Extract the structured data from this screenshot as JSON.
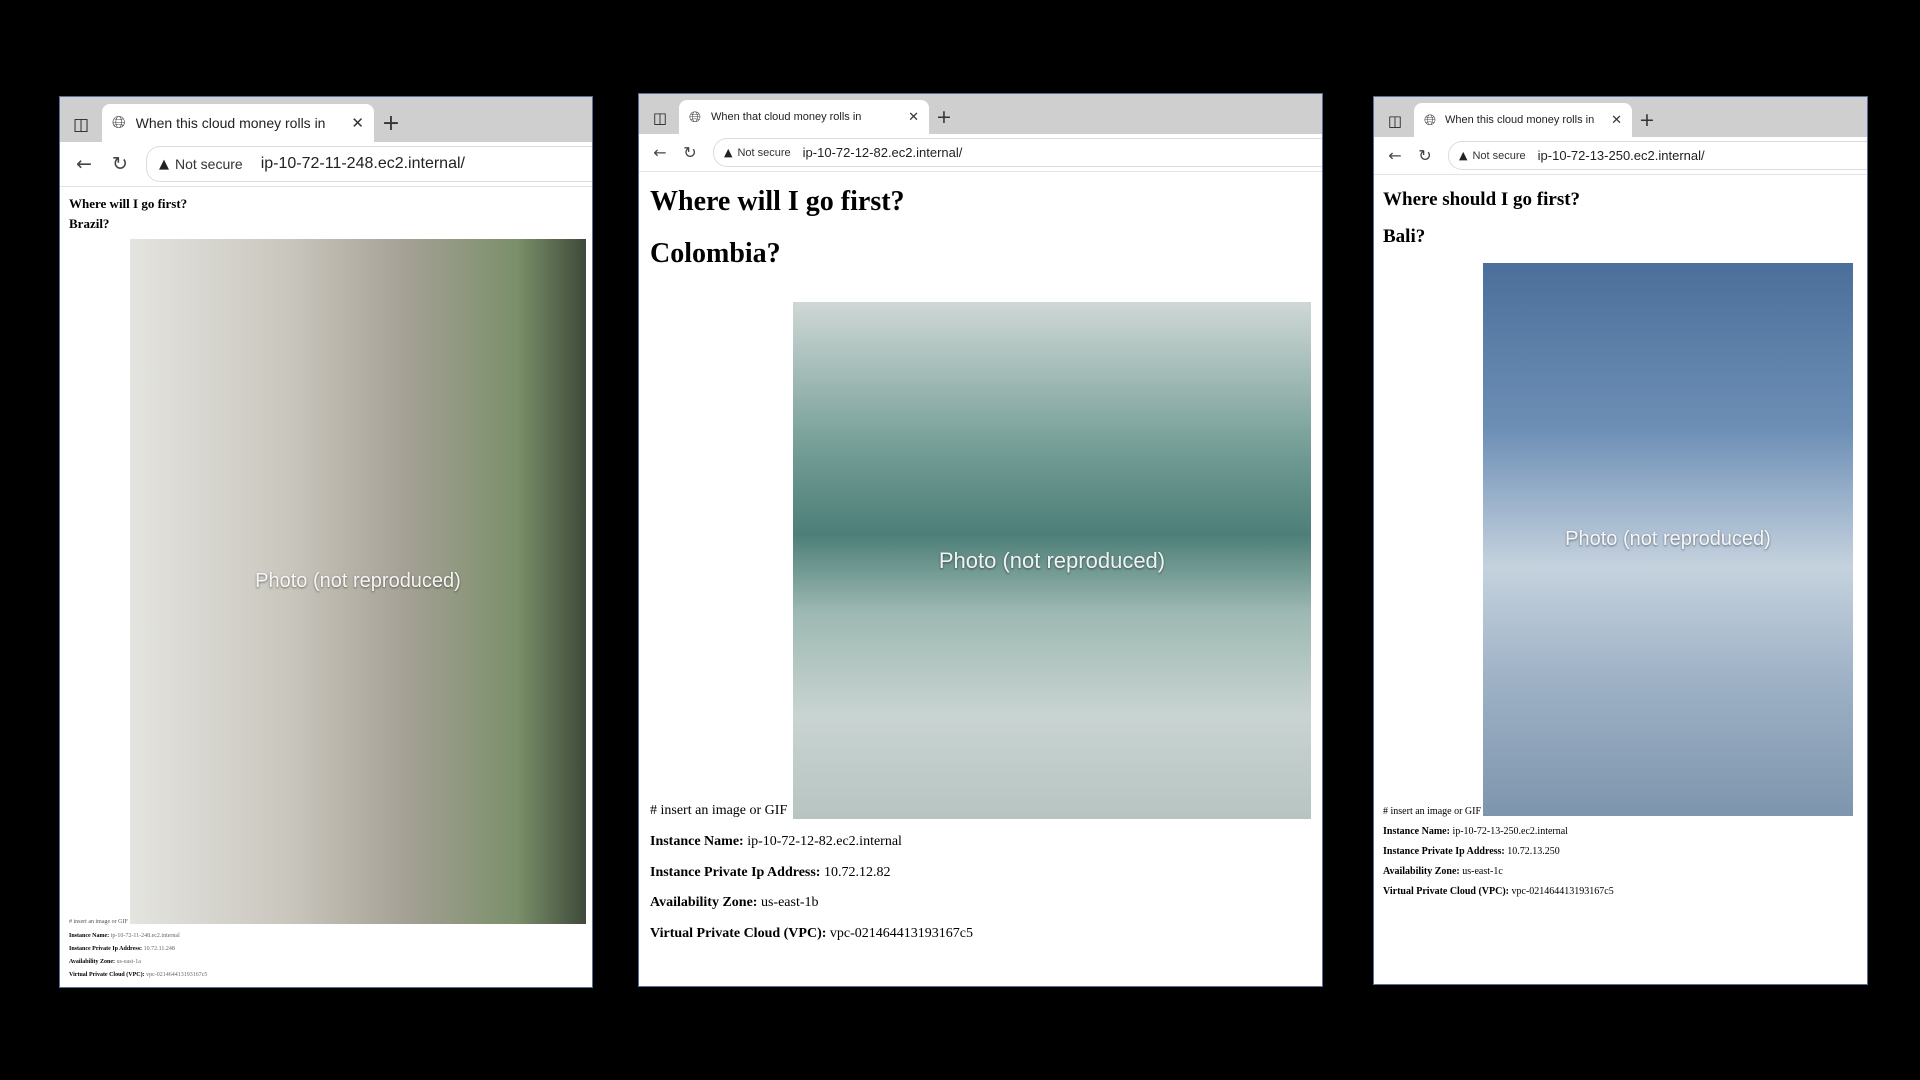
{
  "windows": [
    {
      "tab_title": "When this cloud money rolls in",
      "not_secure_label": "Not secure",
      "url": "ip-10-72-11-248.ec2.internal/",
      "heading_1": "Where will I go first?",
      "heading_2": "Brazil?",
      "image_placeholder": "Photo (not reproduced)",
      "alt_text": "# insert an image or GIF",
      "info": [
        {
          "label": "Instance Name:",
          "value": "ip-10-72-11-248.ec2.internal"
        },
        {
          "label": "Instance Private Ip Address:",
          "value": "10.72.11.248"
        },
        {
          "label": "Availability Zone:",
          "value": "us-east-1a"
        },
        {
          "label": "Virtual Private Cloud (VPC):",
          "value": "vpc-021464413193167c5"
        }
      ]
    },
    {
      "tab_title": "When that cloud money rolls in",
      "not_secure_label": "Not secure",
      "url": "ip-10-72-12-82.ec2.internal/",
      "heading_1": "Where will I go first?",
      "heading_2": "Colombia?",
      "image_placeholder": "Photo (not reproduced)",
      "alt_text": "# insert an image or GIF",
      "info": [
        {
          "label": "Instance Name:",
          "value": "ip-10-72-12-82.ec2.internal"
        },
        {
          "label": "Instance Private Ip Address:",
          "value": "10.72.12.82"
        },
        {
          "label": "Availability Zone:",
          "value": "us-east-1b"
        },
        {
          "label": "Virtual Private Cloud (VPC):",
          "value": "vpc-021464413193167c5"
        }
      ]
    },
    {
      "tab_title": "When this cloud money rolls in",
      "not_secure_label": "Not secure",
      "url": "ip-10-72-13-250.ec2.internal/",
      "heading_1": "Where should I go first?",
      "heading_2": "Bali?",
      "image_placeholder": "Photo (not reproduced)",
      "alt_text": "# insert an image or GIF",
      "info": [
        {
          "label": "Instance Name:",
          "value": "ip-10-72-13-250.ec2.internal"
        },
        {
          "label": "Instance Private Ip Address:",
          "value": "10.72.13.250"
        },
        {
          "label": "Availability Zone:",
          "value": "us-east-1c"
        },
        {
          "label": "Virtual Private Cloud (VPC):",
          "value": "vpc-021464413193167c5"
        }
      ]
    }
  ],
  "icons": {
    "tab_actions": "tab-actions-icon",
    "globe": "globe-icon",
    "close": "close-icon",
    "new_tab": "plus-icon",
    "back": "back-arrow-icon",
    "reload": "reload-icon",
    "warning": "warning-icon"
  },
  "colors": {
    "background": "#000000",
    "tabstrip": "#cfcfcf",
    "window_border": "#5a6e9a"
  }
}
